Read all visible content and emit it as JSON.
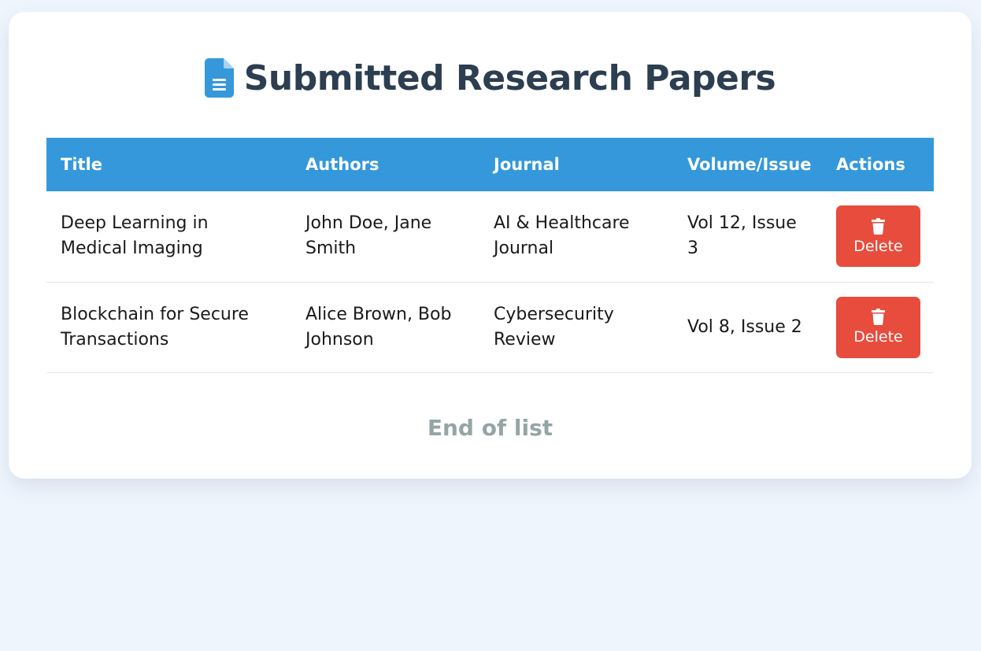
{
  "heading": {
    "title": "Submitted Research Papers",
    "icon": "document-icon"
  },
  "table": {
    "columns": [
      "Title",
      "Authors",
      "Journal",
      "Volume/Issue",
      "Actions"
    ],
    "rows": [
      {
        "title": "Deep Learning in Medical Imaging",
        "authors": "John Doe, Jane Smith",
        "journal": "AI & Healthcare Journal",
        "volume_issue": "Vol 12, Issue 3",
        "action_label": "Delete"
      },
      {
        "title": "Blockchain for Secure Transactions",
        "authors": "Alice Brown, Bob Johnson",
        "journal": "Cybersecurity Review",
        "volume_issue": "Vol 8, Issue 2",
        "action_label": "Delete"
      }
    ]
  },
  "footer": {
    "text": "End of list"
  },
  "colors": {
    "page_background": "#eff5fd",
    "header_background": "#3498db",
    "title_text": "#2c3e50",
    "delete_button": "#e74c3c",
    "muted_text": "#95a5a6"
  }
}
